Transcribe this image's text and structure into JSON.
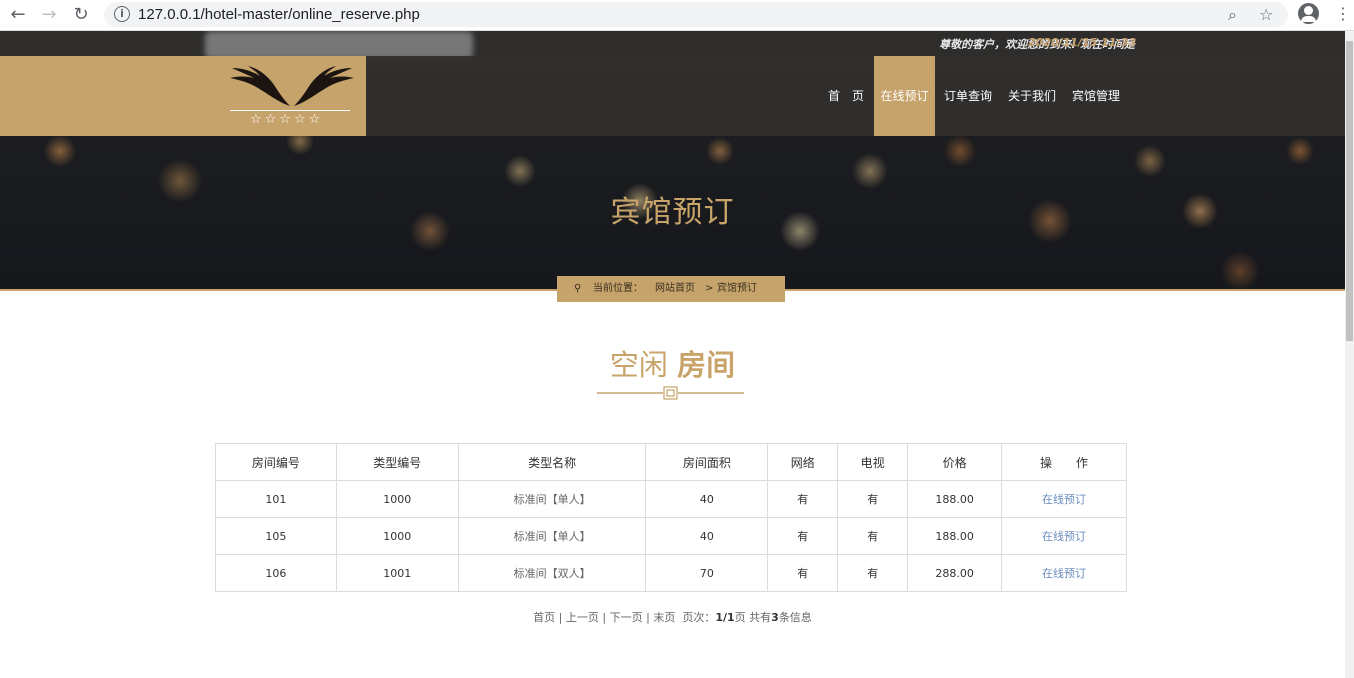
{
  "browser": {
    "back_icon": "←",
    "forward_icon": "→",
    "reload_icon": "↻",
    "url": "127.0.0.1/hotel-master/online_reserve.php",
    "info_icon": "i",
    "zoom_icon": "⌕",
    "star_icon": "☆",
    "menu_icon": "⋮"
  },
  "topbar": {
    "greeting": "尊敬的客户，欢迎您的到来! 现在时间是",
    "time": "2020/11/15 11:33"
  },
  "logo": {
    "stars": "☆☆☆☆☆"
  },
  "nav": {
    "items": [
      {
        "label": "首　页"
      },
      {
        "label": "在线预订"
      },
      {
        "label": "订单查询"
      },
      {
        "label": "关于我们"
      },
      {
        "label": "宾馆管理"
      }
    ],
    "active_index": 1
  },
  "hero": {
    "title": "宾馆预订"
  },
  "breadcrumb": {
    "pin_icon": "⚲",
    "label": "当前位置：",
    "home": "网站首页",
    "sep": ">",
    "current": "宾馆预订"
  },
  "section": {
    "title_light": "空闲",
    "title_bold": "房间"
  },
  "table": {
    "headers": [
      "房间编号",
      "类型编号",
      "类型名称",
      "房间面积",
      "网络",
      "电视",
      "价格",
      "操　　作"
    ],
    "rows": [
      {
        "room": "101",
        "type_id": "1000",
        "type_name": "标准间【单人】",
        "area": "40",
        "net": "有",
        "tv": "有",
        "price": "188.00",
        "action": "在线预订"
      },
      {
        "room": "105",
        "type_id": "1000",
        "type_name": "标准间【单人】",
        "area": "40",
        "net": "有",
        "tv": "有",
        "price": "188.00",
        "action": "在线预订"
      },
      {
        "room": "106",
        "type_id": "1001",
        "type_name": "标准间【双人】",
        "area": "70",
        "net": "有",
        "tv": "有",
        "price": "288.00",
        "action": "在线预订"
      }
    ]
  },
  "pager": {
    "first": "首页",
    "prev": "上一页",
    "next": "下一页",
    "last": "末页",
    "pages_label": "页次：",
    "pages_value": "1/1",
    "pages_unit": "页",
    "total_prefix": "共有",
    "total_count": "3",
    "total_suffix": "条信息",
    "separator": "|"
  },
  "colors": {
    "gold": "#c6a36b",
    "link": "#6a8dbf",
    "dark": "#2e2d2b"
  }
}
